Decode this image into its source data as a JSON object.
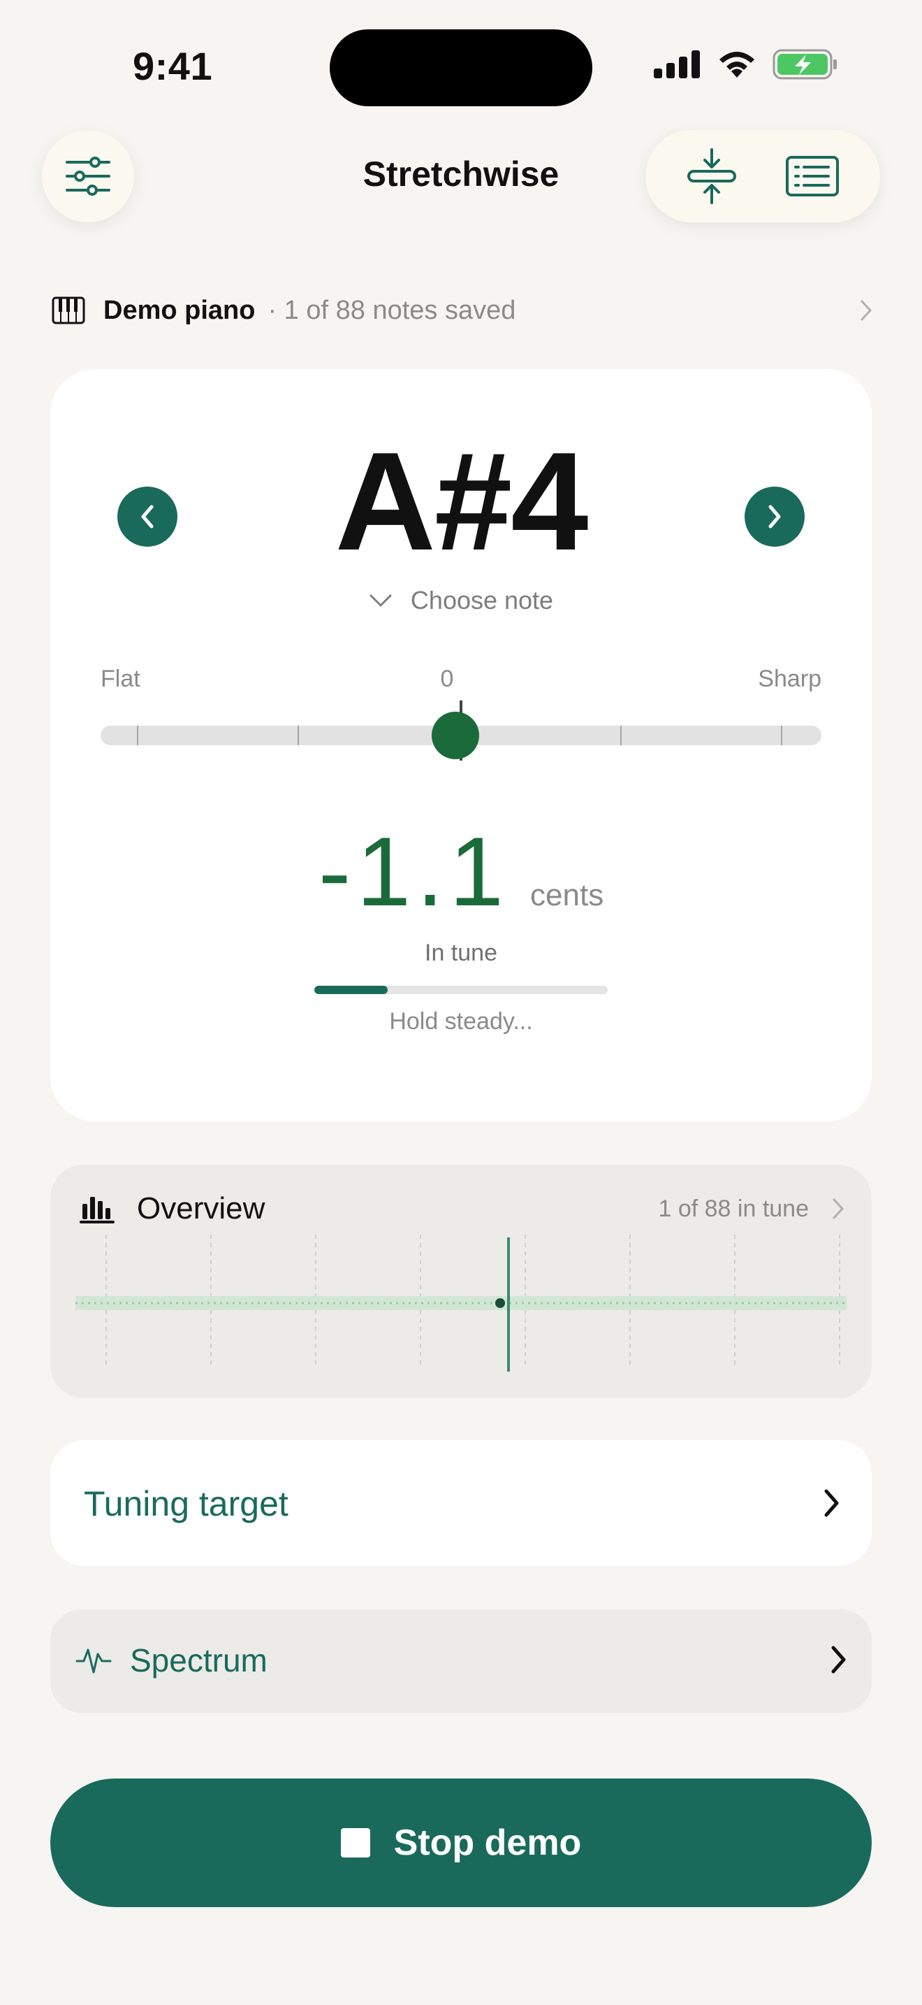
{
  "status_bar": {
    "time": "9:41"
  },
  "header": {
    "title": "Stretchwise"
  },
  "piano": {
    "name": "Demo piano",
    "saved": "· 1 of 88 notes saved"
  },
  "tuner": {
    "note": "A#4",
    "choose_note": "Choose note",
    "flat_label": "Flat",
    "zero_label": "0",
    "sharp_label": "Sharp",
    "cents_value": "-1.1",
    "cents_unit": "cents",
    "status": "In tune",
    "hold_progress": 0.25,
    "hold_text": "Hold steady..."
  },
  "overview": {
    "title": "Overview",
    "count": "1 of 88 in tune"
  },
  "tuning_target": {
    "label": "Tuning target"
  },
  "spectrum": {
    "label": "Spectrum"
  },
  "stop": {
    "label": "Stop demo"
  },
  "colors": {
    "accent": "#1a6a5c",
    "in_tune": "#1b6b3a",
    "background": "#f6f5f2"
  },
  "icons": [
    "sliders-icon",
    "compress-icon",
    "list-icon",
    "piano-icon",
    "chevron-right-icon",
    "chevron-left-icon",
    "chevron-down-icon",
    "bar-chart-icon",
    "pulse-icon",
    "stop-icon",
    "signal-icon",
    "wifi-icon",
    "battery-icon"
  ]
}
